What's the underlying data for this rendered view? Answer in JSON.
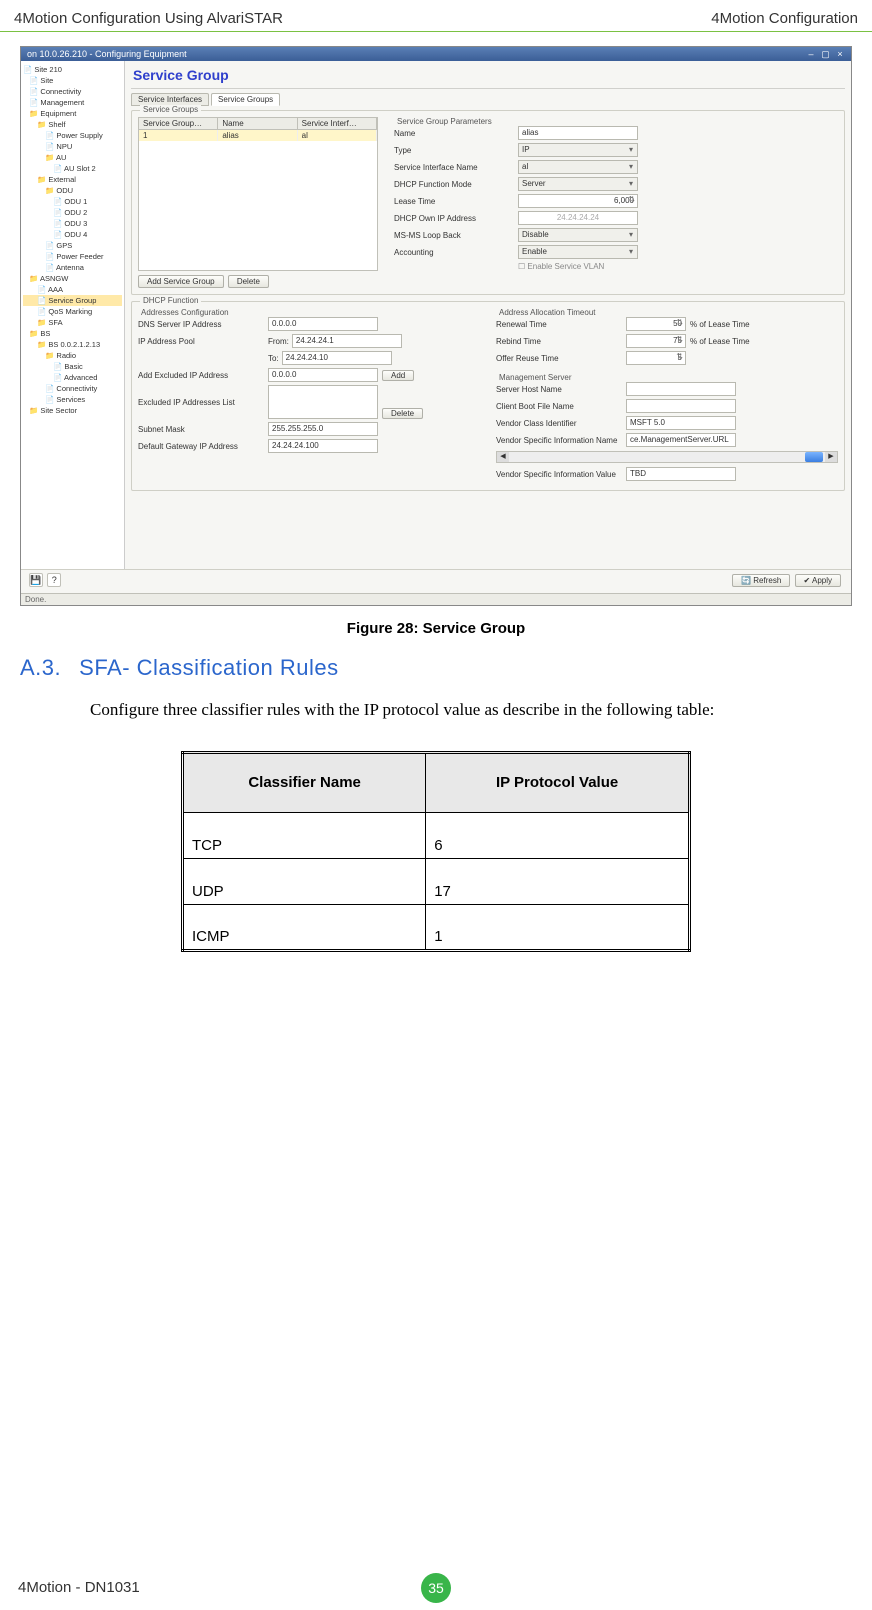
{
  "page_header": {
    "left": "4Motion Configuration Using AlvariSTAR",
    "right": "4Motion Configuration"
  },
  "screenshot": {
    "window_title": "on 10.0.26.210 - Configuring Equipment",
    "tree": [
      {
        "lvl": 0,
        "label": "Site 210"
      },
      {
        "lvl": 1,
        "label": "Site"
      },
      {
        "lvl": 1,
        "label": "Connectivity"
      },
      {
        "lvl": 1,
        "label": "Management"
      },
      {
        "lvl": 1,
        "label": "Equipment",
        "folder": true
      },
      {
        "lvl": 2,
        "label": "Shelf",
        "folder": true
      },
      {
        "lvl": 3,
        "label": "Power Supply"
      },
      {
        "lvl": 3,
        "label": "NPU"
      },
      {
        "lvl": 3,
        "label": "AU",
        "folder": true
      },
      {
        "lvl": 4,
        "label": "AU Slot 2"
      },
      {
        "lvl": 2,
        "label": "External",
        "folder": true
      },
      {
        "lvl": 3,
        "label": "ODU",
        "folder": true
      },
      {
        "lvl": 4,
        "label": "ODU 1"
      },
      {
        "lvl": 4,
        "label": "ODU 2"
      },
      {
        "lvl": 4,
        "label": "ODU 3"
      },
      {
        "lvl": 4,
        "label": "ODU 4"
      },
      {
        "lvl": 3,
        "label": "GPS"
      },
      {
        "lvl": 3,
        "label": "Power Feeder"
      },
      {
        "lvl": 3,
        "label": "Antenna"
      },
      {
        "lvl": 1,
        "label": "ASNGW",
        "folder": true
      },
      {
        "lvl": 2,
        "label": "AAA"
      },
      {
        "lvl": 2,
        "label": "Service Group",
        "hl": true
      },
      {
        "lvl": 2,
        "label": "QoS Marking"
      },
      {
        "lvl": 2,
        "label": "SFA",
        "folder": true
      },
      {
        "lvl": 1,
        "label": "BS",
        "folder": true
      },
      {
        "lvl": 2,
        "label": "BS 0.0.2.1.2.13",
        "folder": true
      },
      {
        "lvl": 3,
        "label": "Radio",
        "folder": true
      },
      {
        "lvl": 4,
        "label": "Basic"
      },
      {
        "lvl": 4,
        "label": "Advanced"
      },
      {
        "lvl": 3,
        "label": "Connectivity"
      },
      {
        "lvl": 3,
        "label": "Services"
      },
      {
        "lvl": 1,
        "label": "Site Sector",
        "folder": true
      }
    ],
    "panel_title": "Service Group",
    "tabs": [
      "Service Interfaces",
      "Service Groups"
    ],
    "active_tab": 1,
    "sg_group_title": "Service Groups",
    "sg_table": {
      "headers": [
        "Service Group…",
        "Name",
        "Service Interf…"
      ],
      "row": [
        "1",
        "alias",
        "al"
      ]
    },
    "sg_buttons": {
      "add": "Add Service Group",
      "delete": "Delete"
    },
    "params_title": "Service Group Parameters",
    "params": {
      "name_l": "Name",
      "name_v": "alias",
      "type_l": "Type",
      "type_v": "IP",
      "sif_l": "Service Interface Name",
      "sif_v": "al",
      "dhcpfm_l": "DHCP Function Mode",
      "dhcpfm_v": "Server",
      "lease_l": "Lease Time",
      "lease_v": "6,000",
      "ownip_l": "DHCP Own IP Address",
      "ownip_v": "24.24.24.24",
      "loop_l": "MS-MS Loop Back",
      "loop_v": "Disable",
      "acct_l": "Accounting",
      "acct_v": "Enable",
      "vlan_chk": "Enable Service VLAN"
    },
    "dhcp_title": "DHCP Function",
    "addr_title": "Addresses Configuration",
    "addr": {
      "dns_l": "DNS Server IP Address",
      "dns_v": "0.0.0.0",
      "pool_l": "IP Address Pool",
      "pool_from_l": "From:",
      "pool_from_v": "24.24.24.1",
      "pool_to_l": "To:",
      "pool_to_v": "24.24.24.10",
      "addex_l": "Add Excluded IP Address",
      "addex_v": "0.0.0.0",
      "addex_b": "Add",
      "exlist_l": "Excluded IP Addresses List",
      "del_b": "Delete",
      "mask_l": "Subnet Mask",
      "mask_v": "255.255.255.0",
      "gw_l": "Default Gateway IP Address",
      "gw_v": "24.24.24.100"
    },
    "timeout_title": "Address Allocation Timeout",
    "timeout": {
      "renew_l": "Renewal Time",
      "renew_v": "50",
      "pct": "% of Lease Time",
      "rebind_l": "Rebind Time",
      "rebind_v": "75",
      "offer_l": "Offer Reuse Time",
      "offer_v": "5"
    },
    "mgmt_title": "Management Server",
    "mgmt": {
      "shost_l": "Server Host Name",
      "shost_v": "",
      "cboot_l": "Client Boot File Name",
      "cboot_v": "",
      "vclass_l": "Vendor Class Identifier",
      "vclass_v": "MSFT 5.0",
      "vsname_l": "Vendor Specific Information Name",
      "vsname_v": "ce.ManagementServer.URL",
      "vsval_l": "Vendor Specific Information Value",
      "vsval_v": "TBD"
    },
    "footer_btns": {
      "refresh": "Refresh",
      "apply": "Apply"
    },
    "statusbar": "Done."
  },
  "figure_caption": "Figure 28: Service Group",
  "section": {
    "num": "A.3.",
    "title": "SFA- Classification Rules"
  },
  "body_text": "Configure three classifier rules with the IP protocol value as describe in the following table:",
  "table": {
    "h1": "Classifier  Name",
    "h2": "IP Protocol Value",
    "rows": [
      {
        "n": "TCP",
        "v": "6"
      },
      {
        "n": "UDP",
        "v": "17"
      },
      {
        "n": "ICMP",
        "v": "1"
      }
    ]
  },
  "footer": {
    "left": "4Motion - DN1031",
    "page": "35"
  }
}
